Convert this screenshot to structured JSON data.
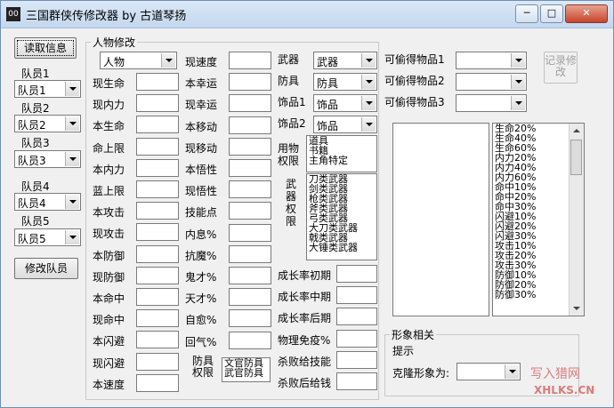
{
  "window": {
    "title": "三国群侠传修改器 by 古道琴扬",
    "icon_text": "00",
    "min": "─",
    "max": "□",
    "close": "✕"
  },
  "left": {
    "read_button": "读取信息",
    "members": [
      {
        "label": "队员1",
        "value": "队员1"
      },
      {
        "label": "队员2",
        "value": "队员2"
      },
      {
        "label": "队员3",
        "value": "队员3"
      },
      {
        "label": "队员4",
        "value": "队员4"
      },
      {
        "label": "队员5",
        "value": "队员5"
      }
    ],
    "modify_button": "修改队员"
  },
  "person": {
    "group_title": "人物修改",
    "type_select": "人物",
    "col1": [
      "现生命",
      "现内力",
      "本生命",
      "命上限",
      "本内力",
      "蓝上限",
      "本攻击",
      "现攻击",
      "本防御",
      "现防御",
      "本命中",
      "现命中",
      "本闪避",
      "现闪避",
      "本速度"
    ],
    "col2": [
      "现速度",
      "本幸运",
      "现幸运",
      "本移动",
      "现移动",
      "本悟性",
      "现悟性",
      "技能点",
      "内息%",
      "抗魔%",
      "鬼才%",
      "天才%",
      "自愈%",
      "回气%"
    ],
    "equip": [
      {
        "label": "武器",
        "value": "武器"
      },
      {
        "label": "防具",
        "value": "防具"
      },
      {
        "label": "饰品1",
        "value": "饰品"
      },
      {
        "label": "饰品2",
        "value": "饰品"
      }
    ],
    "use_perm_label": "用物权限",
    "use_perm_items": [
      "道具",
      "书籍",
      "主角特定"
    ],
    "weapon_perm_label": "武器权限",
    "weapon_perm_items": [
      "刀类武器",
      "剑类武器",
      "枪类武器",
      "斧类武器",
      "弓类武器",
      "大刀类武器",
      "戟类武器",
      "大锤类武器"
    ],
    "armor_perm_label": "防具权限",
    "armor_perm_items": [
      "文官防具",
      "武官防具"
    ],
    "growth": [
      "成长率初期",
      "成长率中期",
      "成长率后期",
      "物理免疫%",
      "杀败给技能",
      "杀败后给钱"
    ]
  },
  "steal": {
    "items": [
      {
        "label": "可偷得物品1",
        "value": ""
      },
      {
        "label": "可偷得物品2",
        "value": ""
      },
      {
        "label": "可偷得物品3",
        "value": ""
      }
    ],
    "record_button": "记录修改"
  },
  "stat_list": [
    "生命20%",
    "生命40%",
    "生命60%",
    "内力20%",
    "内力40%",
    "内力60%",
    "命中10%",
    "命中20%",
    "命中30%",
    "闪避10%",
    "闪避20%",
    "闪避30%",
    "攻击10%",
    "攻击20%",
    "攻击30%",
    "防御10%",
    "防御20%",
    "防御30%"
  ],
  "image": {
    "group_title": "形象相关",
    "hint": "提示",
    "clone_label": "克隆形象为:",
    "clone_value": ""
  },
  "watermark": {
    "line1": "写入猎网",
    "line2": "XHLKS.CN"
  }
}
